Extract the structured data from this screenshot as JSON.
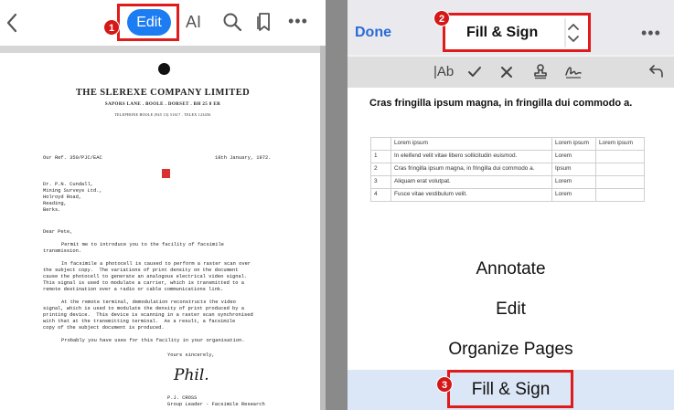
{
  "left": {
    "toolbar": {
      "edit_label": "Edit",
      "ai_label": "AI",
      "badge": "1"
    },
    "document": {
      "company": "THE SLEREXE COMPANY LIMITED",
      "address": "SAPORS LANE . BOOLE . DORSET . BH 25 8 ER",
      "telephone": "TELEPHONE BOOLE (945 13) 51617 . TELEX 123456",
      "our_ref": "Our Ref. 350/PJC/EAC",
      "date": "18th January, 1972.",
      "recipient": [
        "Dr. P.N. Cundall,",
        "Mining Surveys Ltd.,",
        "Holroyd Road,",
        "Reading,",
        "Berks."
      ],
      "salutation": "Dear Pete,",
      "body": [
        "Permit me to introduce you to the facility of facsimile",
        "transmission.",
        "In facsimile a photocell is caused to perform a raster scan over",
        "the subject copy.  The variations of print density on the document",
        "cause the photocell to generate an analogous electrical video signal.",
        "This signal is used to modulate a carrier, which is transmitted to a",
        "remote destination over a radio or cable communications link.",
        "At the remote terminal, demodulation reconstructs the video",
        "signal, which is used to modulate the density of print produced by a",
        "printing device.  This device is scanning in a raster scan synchronised",
        "with that at the transmitting terminal.  As a result, a facsimile",
        "copy of the subject document is produced.",
        "Probably you have uses for this facility in your organisation."
      ],
      "closing": "Yours sincerely,",
      "signature": "Phil.",
      "signer_name": "P.J. CROSS",
      "signer_title": "Group Leader - Facsimile Research"
    }
  },
  "right": {
    "header": {
      "done_label": "Done",
      "mode_label": "Fill & Sign",
      "badge": "2"
    },
    "tools": {
      "text_tool": "|Ab"
    },
    "document": {
      "heading": "Cras fringilla ipsum magna, in fringilla dui commodo a.",
      "table": [
        [
          "",
          "Lorem ipsum",
          "Lorem ipsum",
          "Lorem ipsum"
        ],
        [
          "1",
          "In eleifend velit vitae libero sollicitudin euismod.",
          "Lorem",
          ""
        ],
        [
          "2",
          "Cras fringilla ipsum magna, in fringilla dui commodo a.",
          "Ipsum",
          ""
        ],
        [
          "3",
          "Aliquam erat volutpat.",
          "Lorem",
          ""
        ],
        [
          "4",
          "Fusce vitae vestibulum velit.",
          "Lorem",
          ""
        ]
      ]
    },
    "menu": {
      "items": [
        "Annotate",
        "Edit",
        "Organize Pages",
        "Fill & Sign"
      ],
      "selected": "Fill & Sign",
      "badge": "3"
    }
  },
  "colors": {
    "accent": "#1c7cf2",
    "highlight": "#e01b1b",
    "done_blue": "#2a6bd8",
    "selected_row": "#dbe6f7"
  }
}
